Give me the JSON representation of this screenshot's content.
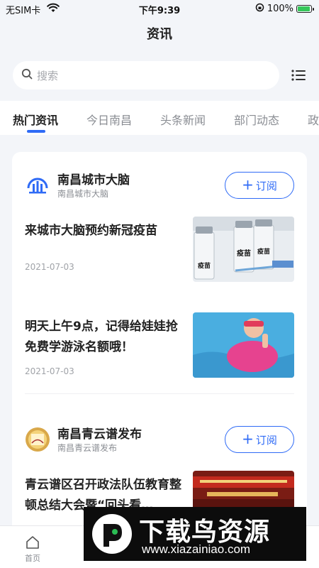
{
  "status_bar": {
    "carrier": "无SIM卡",
    "time": "下午9:39",
    "battery_text": "100%",
    "battery_level": 1.0,
    "icons": [
      "wifi-icon",
      "orientation-lock-icon",
      "battery-charging-icon"
    ]
  },
  "header": {
    "title": "资讯"
  },
  "search": {
    "placeholder": "搜索",
    "icon": "search-icon",
    "menu_icon": "list-icon"
  },
  "tabs": [
    {
      "label": "热门资讯",
      "active": true
    },
    {
      "label": "今日南昌",
      "active": false
    },
    {
      "label": "头条新闻",
      "active": false
    },
    {
      "label": "部门动态",
      "active": false
    },
    {
      "label": "政",
      "active": false
    }
  ],
  "colors": {
    "accent": "#2f6bf6",
    "background": "#f3f5f9",
    "card": "#ffffff"
  },
  "channels": [
    {
      "name": "南昌城市大脑",
      "subtitle": "南昌城市大脑",
      "subscribe_label": "订阅",
      "articles": [
        {
          "title": "来城市大脑预约新冠疫苗",
          "date": "2021-07-03",
          "image_labels": [
            "疫苗",
            "疫苗",
            "疫苗"
          ]
        },
        {
          "title": "明天上午9点，记得给娃娃抢免费学游泳名额哦！",
          "date": "2021-07-03"
        }
      ]
    },
    {
      "name": "南昌青云谱发布",
      "subtitle": "南昌青云谱发布",
      "subscribe_label": "订阅",
      "articles": [
        {
          "title": "青云谱区召开政法队伍教育整顿总结大会暨“回头看…"
        }
      ]
    }
  ],
  "bottom_tabs": [
    {
      "label": "首页",
      "icon": "home-icon"
    }
  ],
  "watermark": {
    "name": "下载鸟资源",
    "url": "www.xiazainiao.com"
  }
}
